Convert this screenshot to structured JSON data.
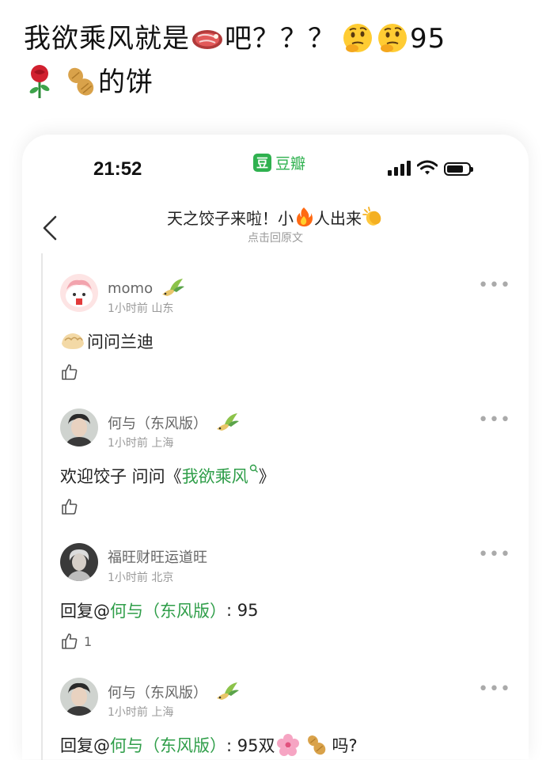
{
  "post": {
    "title_part1": "我欲乘风就是",
    "title_part2": "吧？？？",
    "title_part3": "95",
    "title_part4": "的饼",
    "emojis": [
      "meat-emoji",
      "thinking-face-emoji",
      "rose-emoji",
      "peanut-emoji"
    ]
  },
  "status_bar": {
    "time": "21:52",
    "app_logo": "豆",
    "app_name": "豆瓣"
  },
  "thread": {
    "title_part1": "天之饺子来啦！小",
    "title_part2": "人出来",
    "subtitle": "点击回原文"
  },
  "comments": [
    {
      "username": "momo",
      "meta": "1小时前 山东",
      "text": "问问兰迪",
      "likes": ""
    },
    {
      "username": "何与（东风版）",
      "meta": "1小时前 上海",
      "text_prefix": "欢迎饺子 问问《",
      "link": "我欲乘风",
      "text_suffix": "》",
      "likes": ""
    },
    {
      "username": "福旺财旺运道旺",
      "meta": "1小时前 北京",
      "reply_prefix": "回复@",
      "link": "何与（东风版）",
      "text": ": 95",
      "likes": "1"
    },
    {
      "username": "何与（东风版）",
      "meta": "1小时前 上海",
      "reply_prefix": "回复@",
      "link": "何与（东风版）",
      "text": ": 95双",
      "text_end": "吗?",
      "likes": ""
    }
  ],
  "colors": {
    "link": "#2f9e49",
    "app": "#2fb14f",
    "meta": "#9a9a9a"
  },
  "more_label": "•••"
}
